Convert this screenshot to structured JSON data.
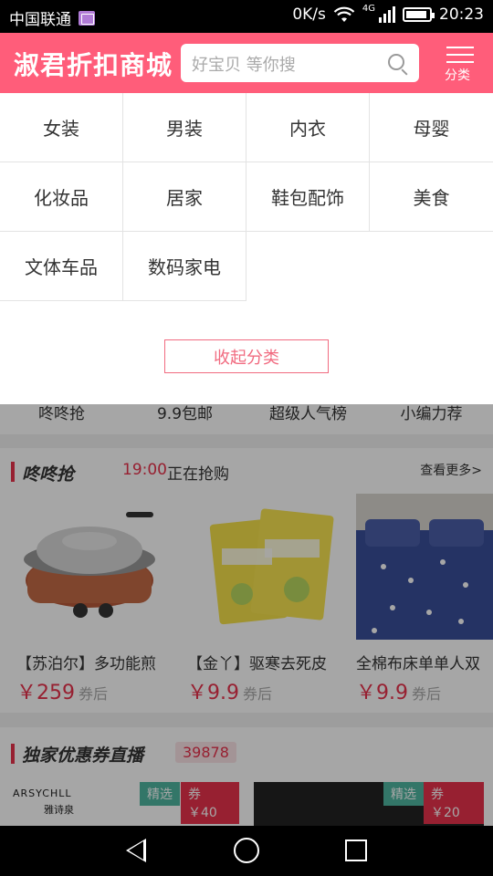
{
  "status_bar": {
    "carrier": "中国联通",
    "network_speed": "0K/s",
    "network_type": "4G",
    "time": "20:23"
  },
  "header": {
    "brand": "淑君折扣商城",
    "search_placeholder": "好宝贝 等你搜",
    "category_label": "分类"
  },
  "categories": [
    {
      "label": "女装"
    },
    {
      "label": "男装"
    },
    {
      "label": "内衣"
    },
    {
      "label": "母婴"
    },
    {
      "label": "化妆品"
    },
    {
      "label": "居家"
    },
    {
      "label": "鞋包配饰"
    },
    {
      "label": "美食"
    },
    {
      "label": "文体车品"
    },
    {
      "label": "数码家电"
    }
  ],
  "collapse_label": "收起分类",
  "quick_nav": [
    "咚咚抢",
    "9.9包邮",
    "超级人气榜",
    "小编力荐"
  ],
  "flash_section": {
    "title": "咚咚抢",
    "time": "19:00",
    "status": "正在抢购",
    "more": "查看更多>"
  },
  "products": [
    {
      "title": "【苏泊尔】多功能煎",
      "price": "￥259",
      "after": "券后"
    },
    {
      "title": "【金丫】驱寒去死皮",
      "price": "￥9.9",
      "after": "券后"
    },
    {
      "title": "全棉布床单单人双",
      "price": "￥9.9",
      "after": "券后"
    }
  ],
  "coupon_section": {
    "title": "独家优惠券直播",
    "count": "39878",
    "items": [
      {
        "tag": "精选",
        "coupon": "券 ￥40",
        "brand_text": "ARSYCHLL",
        "brand_sub": "雅诗泉"
      },
      {
        "tag": "精选",
        "coupon": "券 ￥20"
      }
    ]
  },
  "colors": {
    "header_bg": "#ff5d7a",
    "accent": "#e8324c"
  }
}
